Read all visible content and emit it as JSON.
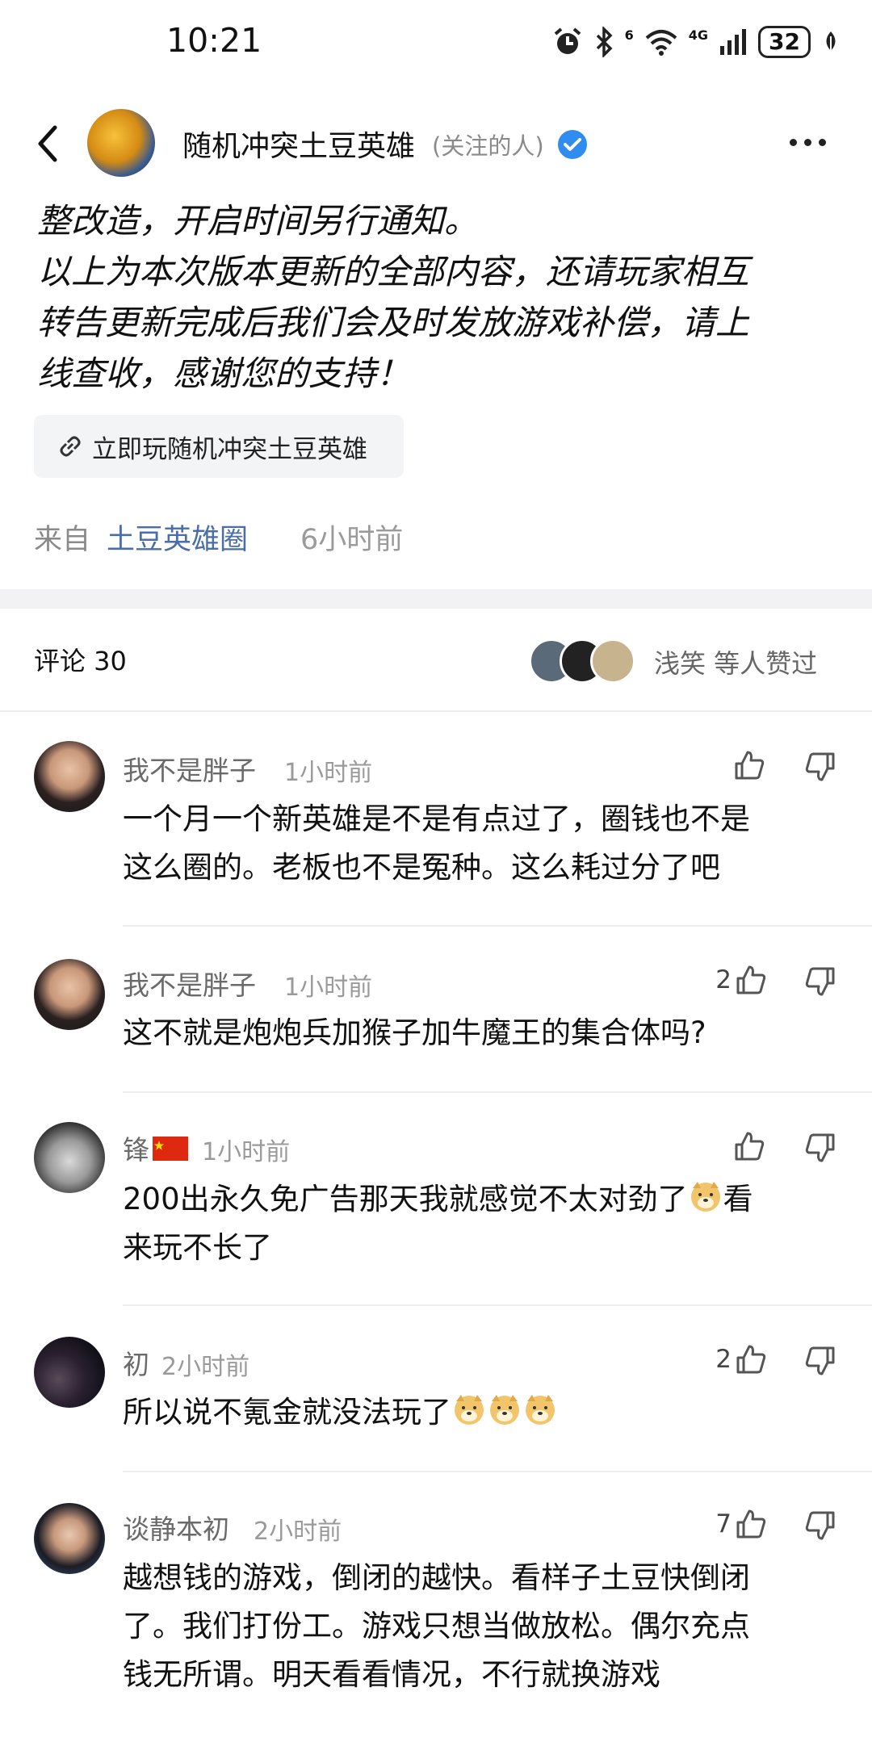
{
  "status_bar": {
    "time": "10:21",
    "battery": "32",
    "network": "4G",
    "sim": "6"
  },
  "header": {
    "account_name": "随机冲突土豆英雄",
    "account_tag": "(关注的人)"
  },
  "post": {
    "lines": [
      "整改造，开启时间另行通知。",
      "以上为本次版本更新的全部内容，还请玩家相互",
      "转告更新完成后我们会及时发放游戏补偿，请上",
      "线查收，感谢您的支持！"
    ],
    "play_link_label": "立即玩随机冲突土豆英雄",
    "source_prefix": "来自",
    "source_link": "土豆英雄圈",
    "time": "6小时前"
  },
  "comments_section": {
    "heading": "评论 30",
    "liker_names": "浅笑  等人赞过"
  },
  "comments": [
    {
      "name": "我不是胖子",
      "time": "1小时前",
      "likes": "",
      "lines": [
        "一个月一个新英雄是不是有点过了，圈钱也不是",
        "这么圈的。老板也不是冤种。这么耗过分了吧"
      ]
    },
    {
      "name": "我不是胖子",
      "time": "1小时前",
      "likes": "2",
      "lines": [
        "这不就是炮炮兵加猴子加牛魔王的集合体吗?"
      ]
    },
    {
      "name": "锋",
      "time": "1小时前",
      "likes": "",
      "lines": [
        "200出永久免广告那天我就感觉不太对劲了",
        "看",
        "来玩不长了"
      ]
    },
    {
      "name": "初",
      "time": "2小时前",
      "likes": "2",
      "lines": [
        "所以说不氪金就没法玩了"
      ]
    },
    {
      "name": "谈静本初",
      "time": "2小时前",
      "likes": "7",
      "lines": [
        "越想钱的游戏，倒闭的越快。看样子土豆快倒闭",
        "了。我们打份工。游戏只想当做放松。偶尔充点",
        "钱无所谓。明天看看情况，不行就换游戏"
      ]
    }
  ],
  "colors": {
    "link": "#4a6ea8",
    "verified": "#2f8cf0",
    "muted": "#8a8a8a"
  }
}
